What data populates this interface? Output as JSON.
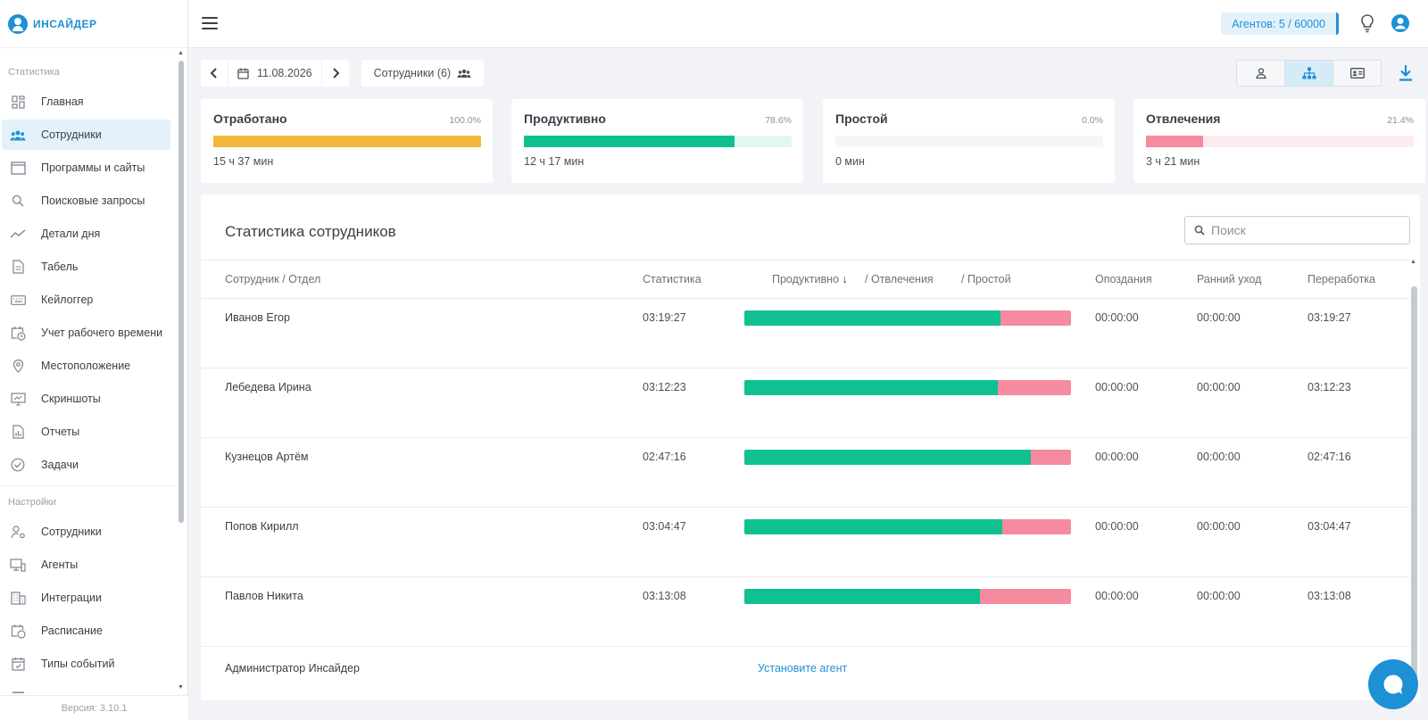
{
  "brand": {
    "name": "ИНСАЙДЕР"
  },
  "sidebar": {
    "section_stats": "Статистика",
    "stats_items": [
      {
        "label": "Главная",
        "icon": "dashboard-icon"
      },
      {
        "label": "Сотрудники",
        "icon": "users-icon",
        "active": true
      },
      {
        "label": "Программы и сайты",
        "icon": "window-icon"
      },
      {
        "label": "Поисковые запросы",
        "icon": "search-icon"
      },
      {
        "label": "Детали дня",
        "icon": "trend-icon"
      },
      {
        "label": "Табель",
        "icon": "document-icon"
      },
      {
        "label": "Кейлоггер",
        "icon": "keyboard-icon"
      },
      {
        "label": "Учет рабочего времени",
        "icon": "clock-calendar-icon"
      },
      {
        "label": "Местоположение",
        "icon": "location-icon"
      },
      {
        "label": "Скриншоты",
        "icon": "screenshot-icon"
      },
      {
        "label": "Отчеты",
        "icon": "report-icon"
      },
      {
        "label": "Задачи",
        "icon": "check-circle-icon"
      }
    ],
    "section_settings": "Настройки",
    "settings_items": [
      {
        "label": "Сотрудники",
        "icon": "user-settings-icon"
      },
      {
        "label": "Агенты",
        "icon": "agent-monitor-icon"
      },
      {
        "label": "Интеграции",
        "icon": "building-icon"
      },
      {
        "label": "Расписание",
        "icon": "schedule-icon"
      },
      {
        "label": "Типы событий",
        "icon": "calendar-check-icon"
      },
      {
        "label": "",
        "icon": "calendar-icon"
      }
    ],
    "version": "Версия: 3.10.1"
  },
  "topbar": {
    "agents": "Агентов: 5 / 60000"
  },
  "toolbar": {
    "date": "11.08.2026",
    "employees_filter": "Сотрудники (6)"
  },
  "summary": [
    {
      "title": "Отработано",
      "percent": "100.0%",
      "value": "15 ч 37 мин",
      "fill": 100,
      "color": "#f3b83c",
      "track": "#fdf3dc"
    },
    {
      "title": "Продуктивно",
      "percent": "78.6%",
      "value": "12 ч 17 мин",
      "fill": 78.6,
      "color": "#0fc190",
      "track": "#e3f7f1"
    },
    {
      "title": "Простой",
      "percent": "0.0%",
      "value": "0 мин",
      "fill": 0,
      "color": "#b0b7c0",
      "track": "#f4f6f8"
    },
    {
      "title": "Отвлечения",
      "percent": "21.4%",
      "value": "3 ч 21 мин",
      "fill": 21.4,
      "color": "#f68a9f",
      "track": "#fdecef"
    }
  ],
  "table": {
    "title": "Статистика сотрудников",
    "search_placeholder": "Поиск",
    "headers": {
      "employee": "Сотрудник / Отдел",
      "stats": "Статистика",
      "productive": "Продуктивно",
      "sort_arrow": "↓",
      "distraction": "/ Отвлечения",
      "idle": "/ Простой",
      "late": "Опоздания",
      "early": "Ранний уход",
      "overtime": "Переработка"
    },
    "rows": [
      {
        "name": "Иванов Егор",
        "stat": "03:19:27",
        "productive_pct": 78.5,
        "late": "00:00:00",
        "early": "00:00:00",
        "over": "03:19:27"
      },
      {
        "name": "Лебедева Ирина",
        "stat": "03:12:23",
        "productive_pct": 77.7,
        "late": "00:00:00",
        "early": "00:00:00",
        "over": "03:12:23"
      },
      {
        "name": "Кузнецов Артём",
        "stat": "02:47:16",
        "productive_pct": 87.7,
        "late": "00:00:00",
        "early": "00:00:00",
        "over": "02:47:16"
      },
      {
        "name": "Попов Кирилл",
        "stat": "03:04:47",
        "productive_pct": 78.9,
        "late": "00:00:00",
        "early": "00:00:00",
        "over": "03:04:47"
      },
      {
        "name": "Павлов Никита",
        "stat": "03:13:08",
        "productive_pct": 72.2,
        "late": "00:00:00",
        "early": "00:00:00",
        "over": "03:13:08"
      }
    ],
    "admin_row": {
      "name": "Администратор Инсайдер",
      "action": "Установите агент"
    }
  }
}
